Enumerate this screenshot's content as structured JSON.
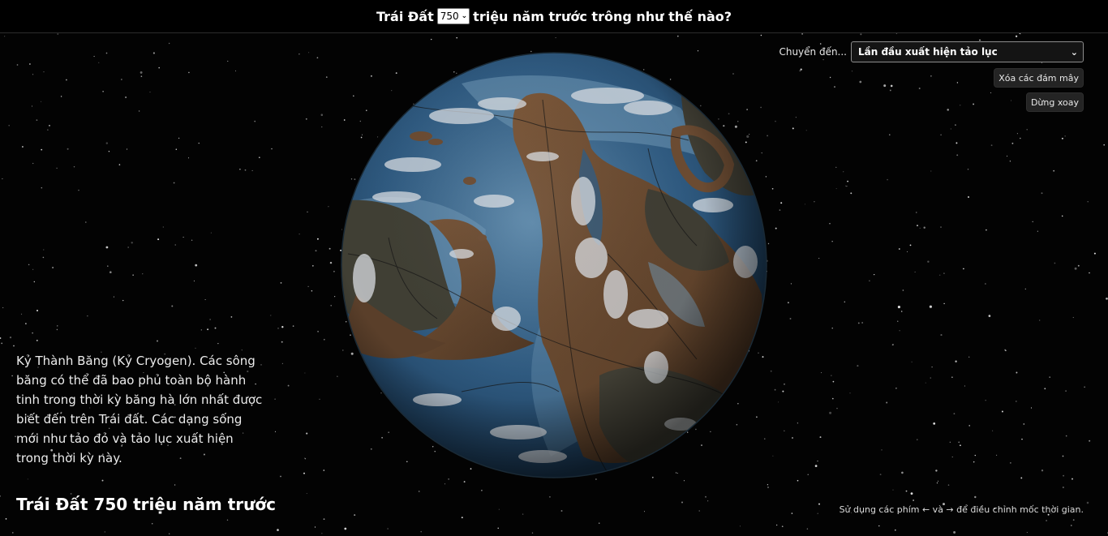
{
  "header": {
    "prefix": "Trái Đất",
    "year_value": "750",
    "suffix": "triệu năm trước trông như thế nào?"
  },
  "controls": {
    "jump_label": "Chuyển đến...",
    "jump_selected": "Lần đầu xuất hiện tảo lục",
    "clear_clouds_label": "Xóa các đám mây",
    "stop_rotation_label": "Dừng xoay"
  },
  "description": "Kỷ Thành Băng (Kỷ Cryogen). Các sông băng có thể đã bao phủ toàn bộ hành tinh trong thời kỳ băng hà lớn nhất được biết đến trên Trái đất. Các dạng sống mới như tảo đỏ và tảo lục xuất hiện trong thời kỳ này.",
  "age_caption": "Trái Đất 750 triệu năm trước",
  "hint": "Sử dụng các phím ← và → để điều chỉnh mốc thời gian.",
  "icons": {
    "dropdown": "chevron-down-icon",
    "keys": [
      "arrow-left",
      "arrow-right"
    ]
  },
  "colors": {
    "ocean_deep": "#2c5377",
    "ocean_shallow": "#6f97b5",
    "land_brown": "#6b4b32",
    "land_dark": "#3f3d33",
    "clouds": "#d9dde2",
    "space": "#030303"
  }
}
